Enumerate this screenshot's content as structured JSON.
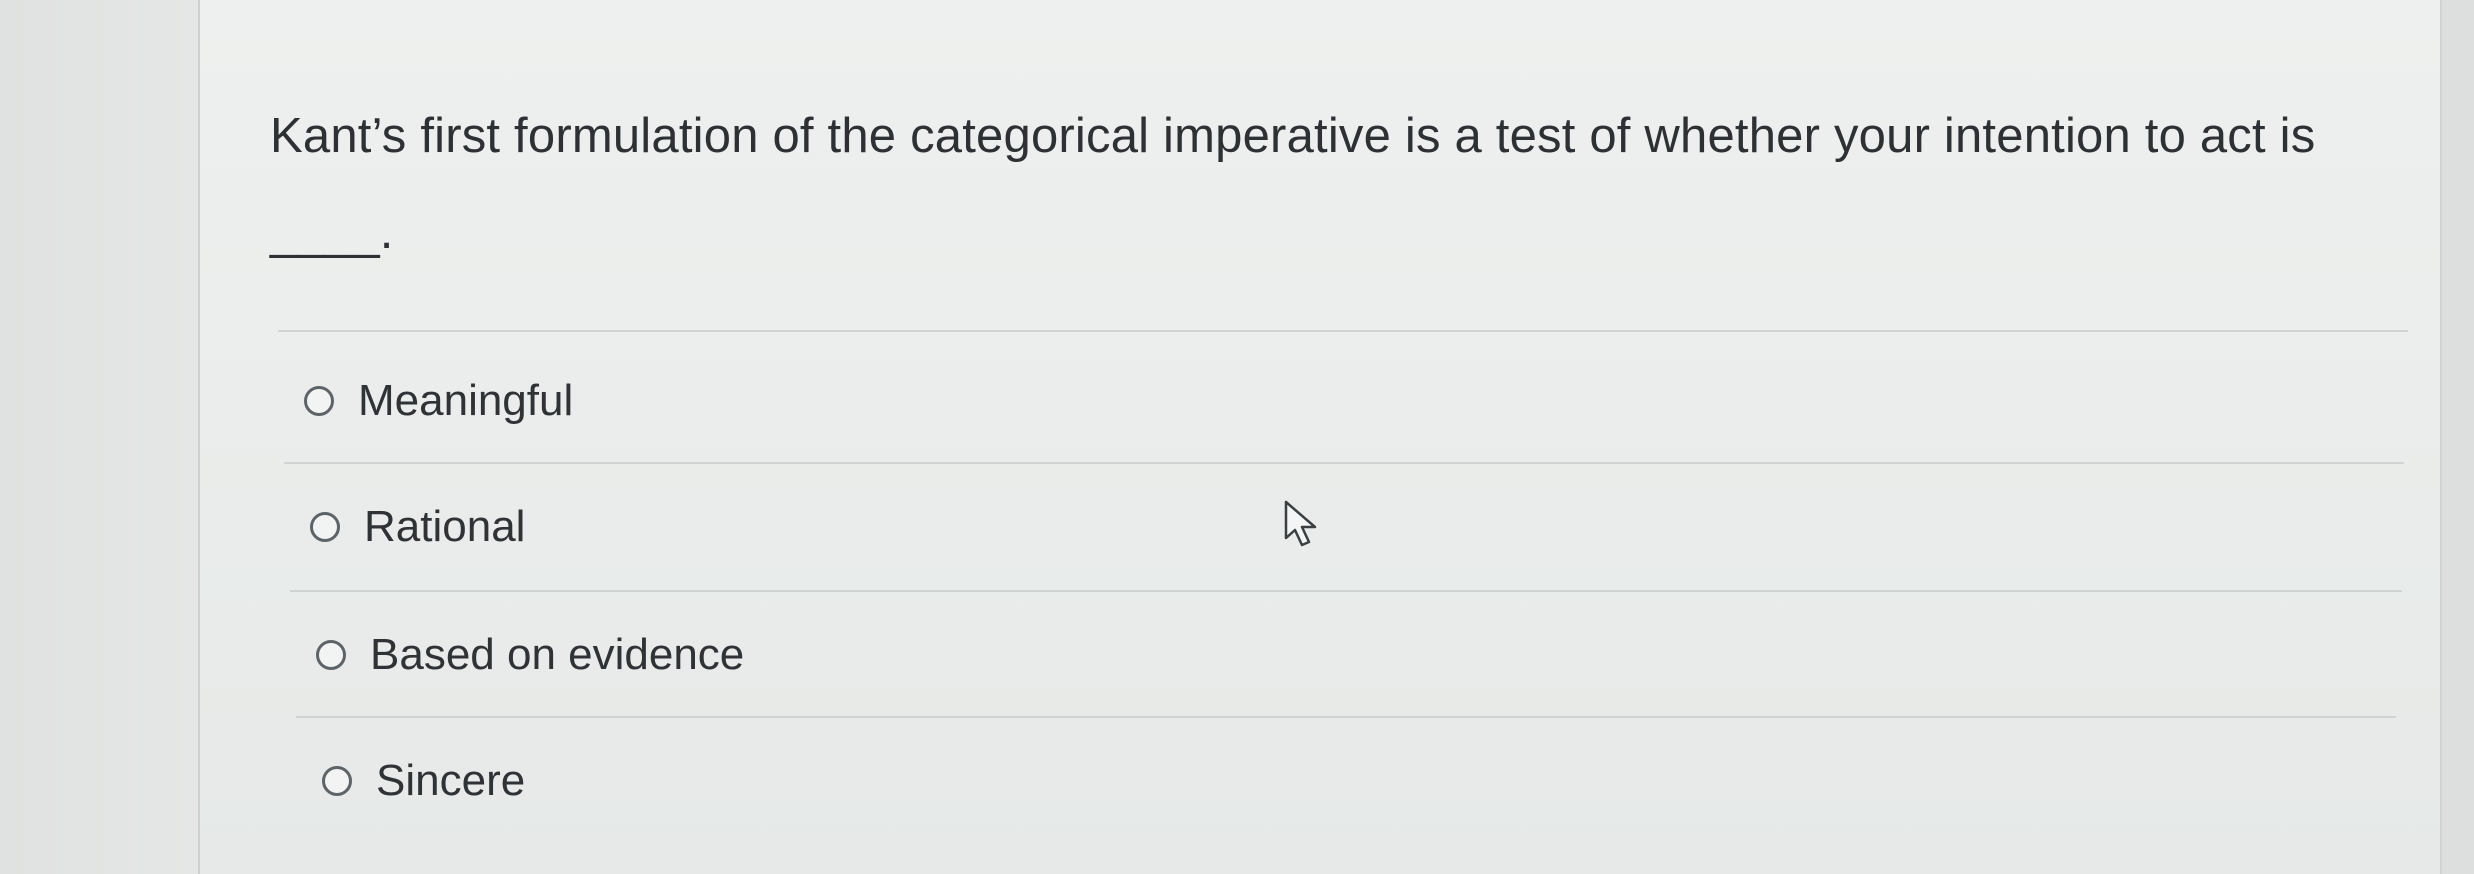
{
  "question": {
    "text": "Kant’s first formulation of the categorical imperative is a test of whether your intention to act is ____."
  },
  "options": [
    {
      "label": "Meaningful",
      "selected": false
    },
    {
      "label": "Rational",
      "selected": false
    },
    {
      "label": "Based on evidence",
      "selected": false
    },
    {
      "label": "Sincere",
      "selected": false
    }
  ],
  "icons": {
    "radio": "radio-button-icon",
    "cursor": "mouse-pointer-icon"
  },
  "colors": {
    "text": "#2d3133",
    "panel": "#eef0ef",
    "divider": "#cfd4d2"
  }
}
